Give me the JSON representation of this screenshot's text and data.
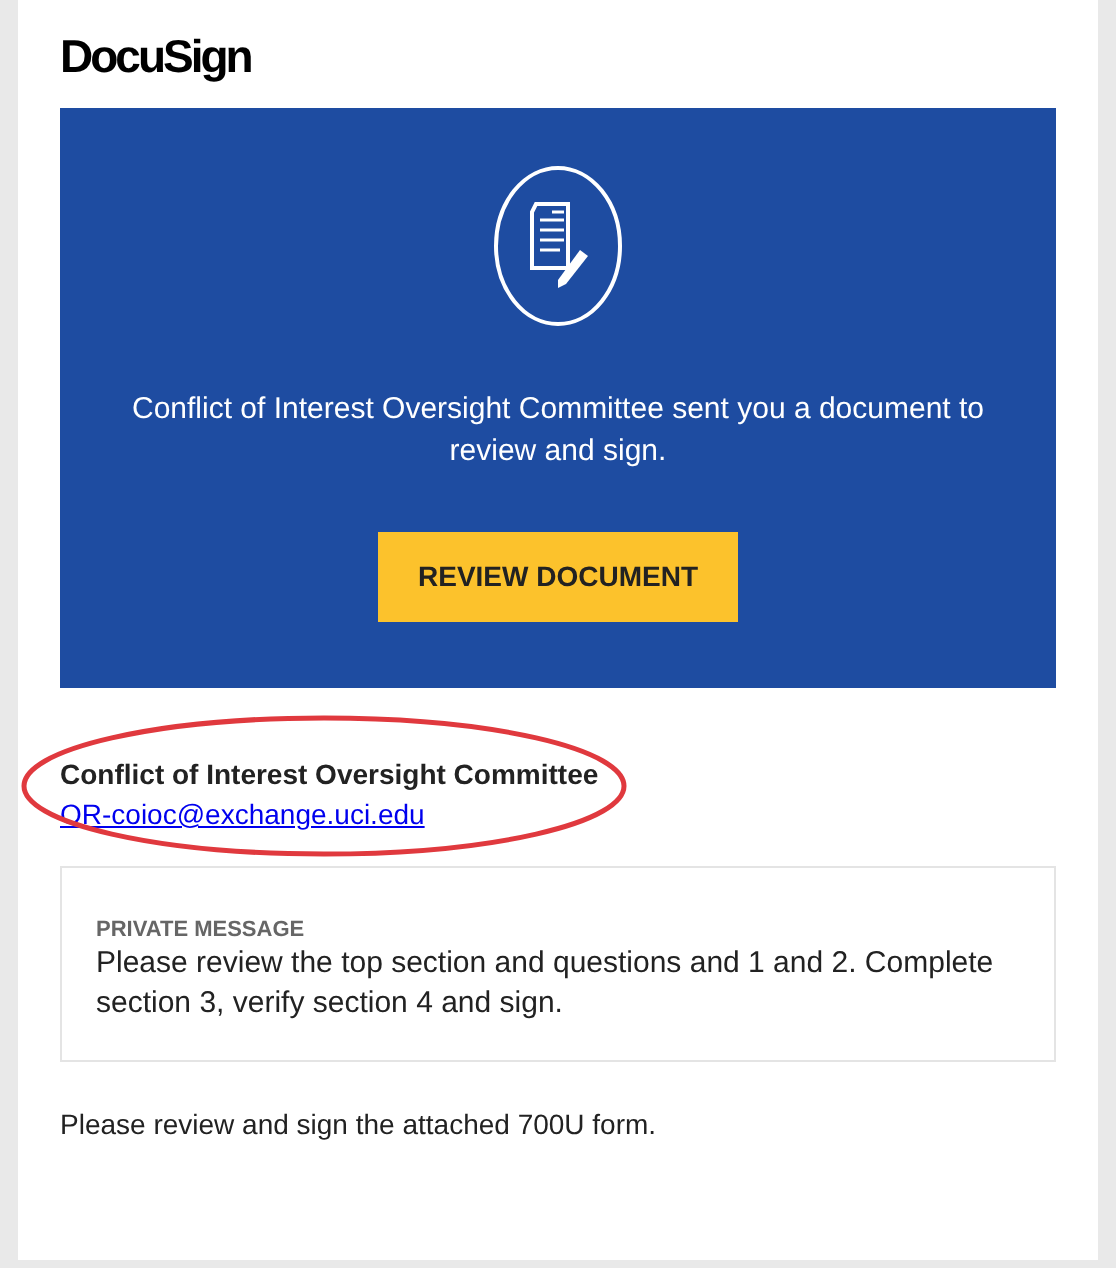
{
  "logo": {
    "text": "DocuSign"
  },
  "banner": {
    "message": "Conflict of Interest Oversight Committee sent you a document to review and sign.",
    "button": "REVIEW DOCUMENT"
  },
  "sender": {
    "name": "Conflict of Interest Oversight Committee",
    "email": "OR-coioc@exchange.uci.edu",
    "highlighted": true
  },
  "private_message": {
    "heading": "PRIVATE MESSAGE",
    "body": "Please review the top section and questions and 1 and 2. Complete section 3, verify section 4 and sign."
  },
  "footer_text": "Please review and sign the attached 700U form."
}
